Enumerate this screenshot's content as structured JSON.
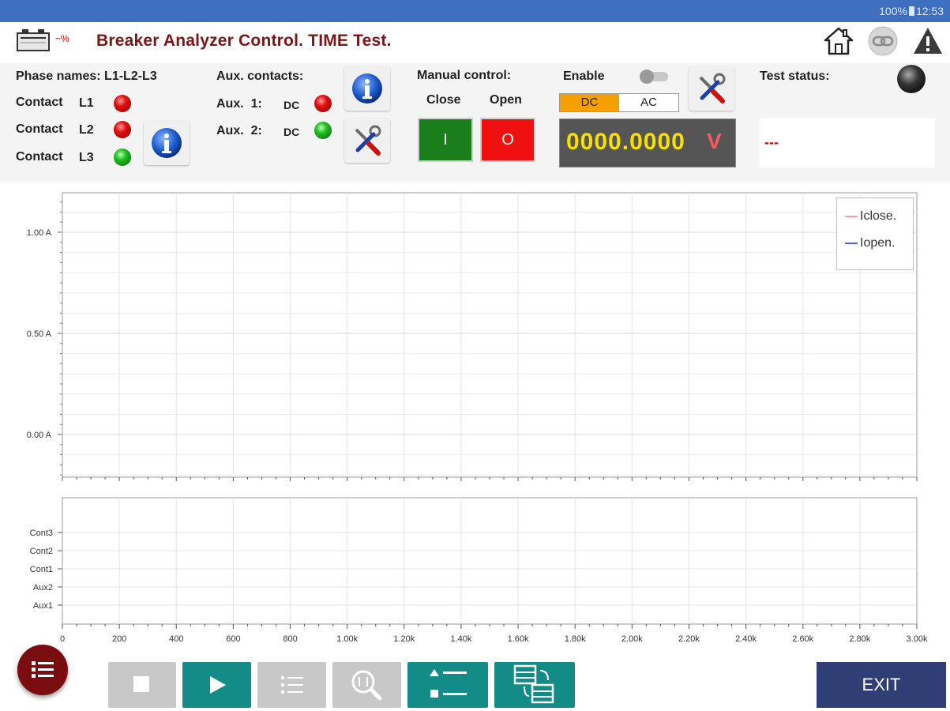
{
  "status_bar": {
    "battery": "100%",
    "time": "12:53"
  },
  "header": {
    "title": "Breaker Analyzer Control. TIME Test.",
    "logo_text": "~%",
    "icons": [
      "home-icon",
      "link-icon",
      "warning-icon"
    ]
  },
  "phases": {
    "label": "Phase names: L1-L2-L3",
    "contact_word": "Contact",
    "contacts": [
      {
        "name": "L1",
        "state": "red"
      },
      {
        "name": "L2",
        "state": "red"
      },
      {
        "name": "L3",
        "state": "green"
      }
    ]
  },
  "aux": {
    "label": "Aux. contacts:",
    "items": [
      {
        "name": "Aux.  1:",
        "type": "DC",
        "state": "red"
      },
      {
        "name": "Aux.  2:",
        "type": "DC",
        "state": "green"
      }
    ]
  },
  "manual": {
    "label": "Manual control:",
    "close_label": "Close",
    "open_label": "Open",
    "close_button": "I",
    "open_button": "O"
  },
  "voltage": {
    "enable_label": "Enable",
    "modes": [
      "DC",
      "AC"
    ],
    "selected_mode": "DC",
    "reading": "0000.0000",
    "unit": "V"
  },
  "test_status": {
    "label": "Test status:",
    "value": "---"
  },
  "chart_data": [
    {
      "type": "line",
      "ylabel_ticks": [
        "1.00 A",
        "0.50 A",
        "0.00 A"
      ],
      "yticks_values": [
        1.0,
        0.5,
        0.0
      ],
      "series": [
        {
          "name": "Iclose.",
          "color": "#f4a0a8",
          "values": []
        },
        {
          "name": "Iopen.",
          "color": "#5060e0",
          "values": []
        }
      ],
      "grid": true,
      "legend": "top-right"
    },
    {
      "type": "line",
      "categories": [
        "Cont3",
        "Cont2",
        "Cont1",
        "Aux2",
        "Aux1"
      ],
      "x_ticks": [
        "0",
        "200",
        "400",
        "600",
        "800",
        "1.00k",
        "1.20k",
        "1.40k",
        "1.60k",
        "1.80k",
        "2.00k",
        "2.20k",
        "2.40k",
        "2.60k",
        "2.80k",
        "3.00k"
      ],
      "xlim": [
        0,
        3000
      ],
      "series": [],
      "grid": true
    }
  ],
  "toolbar": {
    "buttons": [
      {
        "name": "stop-icon",
        "enabled": false
      },
      {
        "name": "play-icon",
        "enabled": true
      },
      {
        "name": "list-icon",
        "enabled": false
      },
      {
        "name": "zoom-icon",
        "enabled": false
      },
      {
        "name": "sort-icon",
        "enabled": true
      },
      {
        "name": "compare-icon",
        "enabled": true
      }
    ],
    "exit_label": "EXIT"
  },
  "colors": {
    "title": "#7a1518",
    "status_bar": "#3f6fbf",
    "close_green": "#1a7f1a",
    "open_red": "#f01010",
    "dc_selected": "#f5a000",
    "meter_bg": "#555555",
    "meter_value": "#f5e000",
    "toolbar_teal": "#138c87",
    "exit_bg": "#2f3e74"
  }
}
